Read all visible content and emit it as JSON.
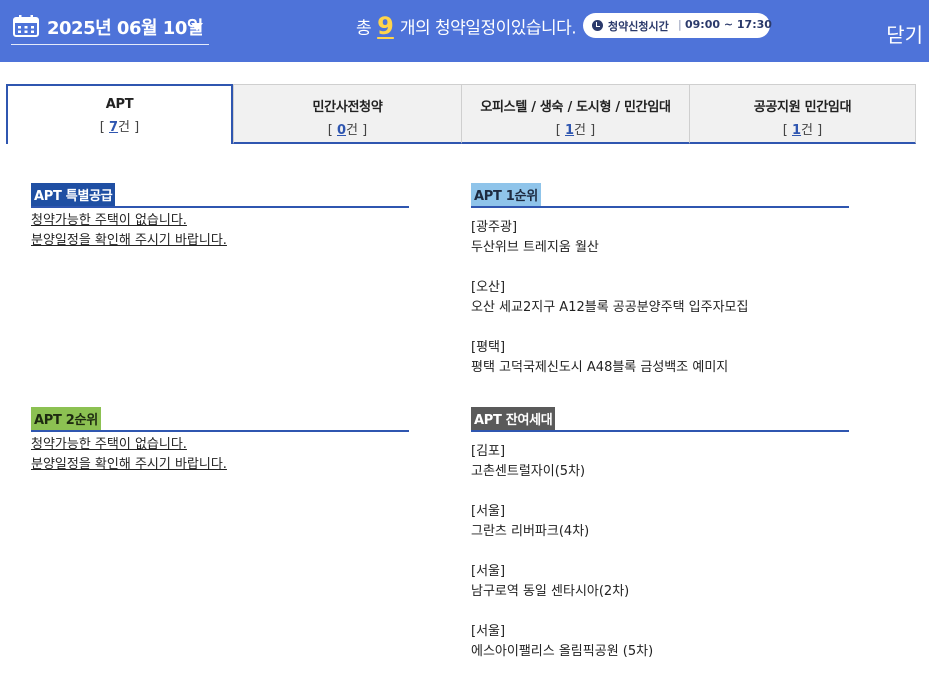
{
  "header": {
    "date": "2025년 06월 10일",
    "summary_prefix": "총",
    "count": "9",
    "summary_suffix": "개의 청약일정이있습니다.",
    "time_label": "청약신청시간",
    "time_sep": "|",
    "time_range": "09:00 ~ 17:30",
    "close_label": "닫기",
    "colors": {
      "bar": "#4e73d9",
      "count": "#ffd44a"
    }
  },
  "tabs": [
    {
      "label": "APT",
      "count": "7",
      "active": true
    },
    {
      "label": "민간사전청약",
      "count": "0"
    },
    {
      "label": "오피스텔 / 생숙 / 도시형 / 민간임대",
      "count": "1"
    },
    {
      "label": "공공지원 민간임대",
      "count": "1"
    }
  ],
  "count_open": "[ ",
  "count_close": "건 ]",
  "sections": {
    "special": {
      "title": "APT 특별공급",
      "empty_line1": "청약가능한 주택이 없습니다.",
      "empty_line2": "분양일정을 확인해 주시기 바랍니다."
    },
    "first": {
      "title": "APT 1순위",
      "entries": [
        {
          "region": "[광주광]",
          "name": "두산위브 트레지움 월산"
        },
        {
          "region": "[오산]",
          "name": "오산 세교2지구 A12블록 공공분양주택 입주자모집"
        },
        {
          "region": "[평택]",
          "name": "평택 고덕국제신도시 A48블록 금성백조 예미지"
        }
      ]
    },
    "second": {
      "title": "APT 2순위",
      "empty_line1": "청약가능한 주택이 없습니다.",
      "empty_line2": "분양일정을 확인해 주시기 바랍니다."
    },
    "remain": {
      "title": "APT 잔여세대",
      "entries": [
        {
          "region": "[김포]",
          "name": "고촌센트럴자이(5차)"
        },
        {
          "region": "[서울]",
          "name": "그란츠 리버파크(4차)"
        },
        {
          "region": "[서울]",
          "name": "남구로역 동일 센타시아(2차)"
        },
        {
          "region": "[서울]",
          "name": "에스아이팰리스 올림픽공원 (5차)"
        }
      ]
    }
  }
}
